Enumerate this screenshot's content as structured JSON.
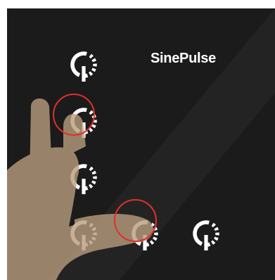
{
  "app": {
    "title": "SinePulse"
  },
  "buttons": [
    {
      "id": "power-r1-c1",
      "icon": "power-icon",
      "state": "idle"
    },
    {
      "id": "power-r2-c1",
      "icon": "power-icon",
      "state": "touched"
    },
    {
      "id": "power-r3-c1",
      "icon": "power-icon",
      "state": "idle"
    },
    {
      "id": "power-r4-c1",
      "icon": "power-icon",
      "state": "idle"
    },
    {
      "id": "power-r4-c2",
      "icon": "power-icon",
      "state": "touched"
    },
    {
      "id": "power-r4-c3",
      "icon": "power-icon",
      "state": "idle"
    }
  ],
  "colors": {
    "background": "#1b1b1b",
    "icon": "#ffffff",
    "icon_under_hand": "#f5dcc0",
    "hand": "#b89d7e",
    "tap_ring": "#e0302a"
  }
}
